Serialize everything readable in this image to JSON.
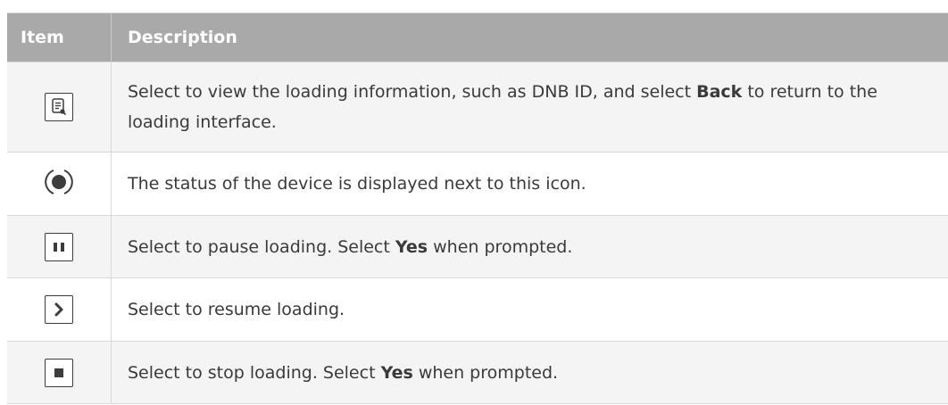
{
  "header": {
    "item": "Item",
    "description": "Description"
  },
  "rows": [
    {
      "icon": "info-document-icon",
      "parts": [
        "Select to view the loading information, such as DNB ID, and select ",
        "Back",
        " to return to the loading interface."
      ]
    },
    {
      "icon": "status-dot-icon",
      "parts": [
        "The status of the device is displayed next to this icon.",
        "",
        ""
      ]
    },
    {
      "icon": "pause-icon",
      "parts": [
        "Select to pause loading. Select ",
        "Yes",
        " when prompted."
      ]
    },
    {
      "icon": "resume-icon",
      "parts": [
        "Select to resume loading.",
        "",
        ""
      ]
    },
    {
      "icon": "stop-icon",
      "parts": [
        "Select to stop loading. Select ",
        "Yes",
        " when prompted."
      ]
    }
  ],
  "colors": {
    "header_bg": "#a9a9a9",
    "header_text": "#ffffff",
    "row_alt_bg": "#f4f4f4",
    "text": "#3a3a3a"
  }
}
